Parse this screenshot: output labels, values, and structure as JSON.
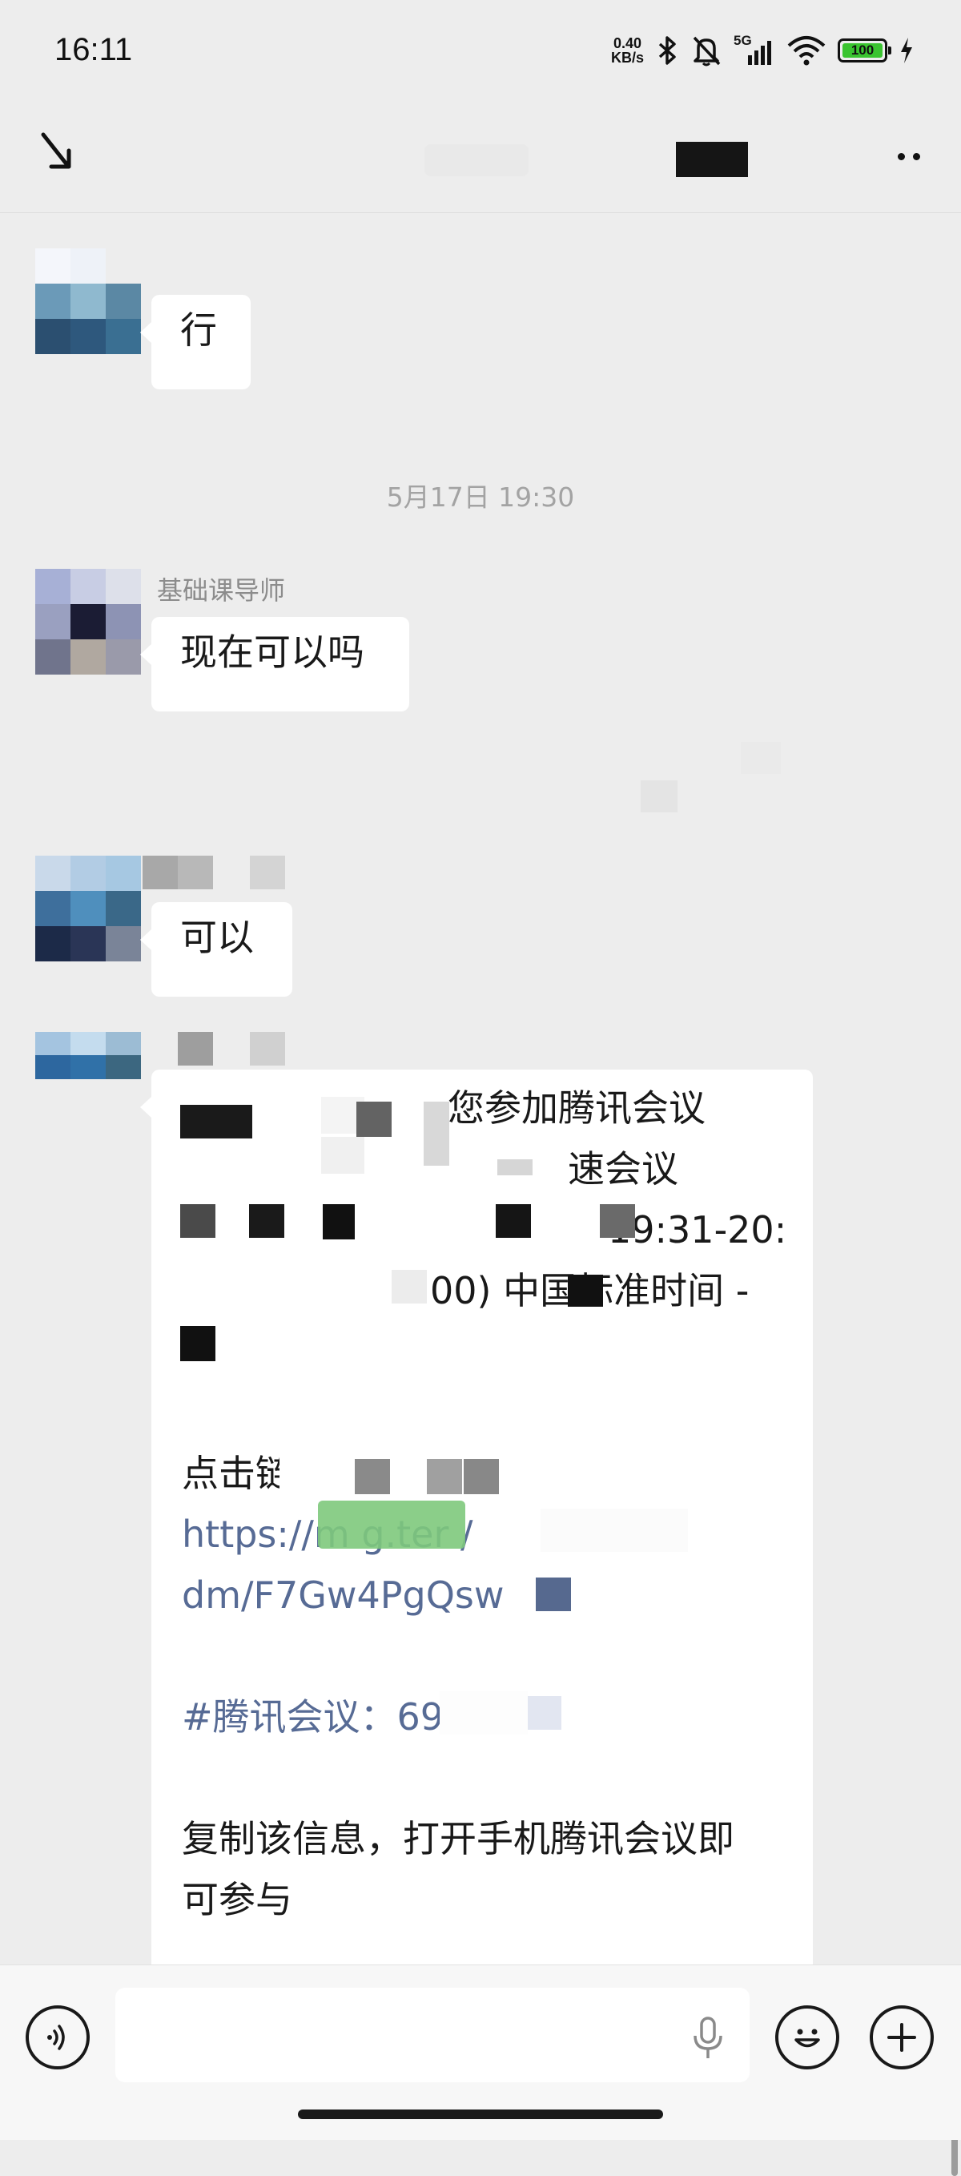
{
  "status_bar": {
    "time": "16:11",
    "net_speed_value": "0.40",
    "net_speed_unit": "KB/s",
    "network": "5G",
    "battery": "100",
    "icons": [
      "bluetooth-icon",
      "bell-muted-icon",
      "signal-icon",
      "wifi-icon",
      "battery-icon",
      "charging-icon"
    ]
  },
  "nav": {
    "back_icon": "back-arrow-icon",
    "more_icon": "more-icon"
  },
  "chat": {
    "messages": [
      {
        "text": "行"
      },
      {
        "timestamp": "5月17日 19:30"
      },
      {
        "sender": "基础课导师",
        "text": "现在可以吗"
      },
      {
        "text": "可以"
      },
      {
        "lines": [
          "您参加腾讯会议",
          "速会议",
          "19:31-20:",
          "00) 中国标准时间 -",
          "",
          "点击链接入会",
          "https://m         g.ter              /",
          "dm/F7Gw4PgQsw",
          "#腾讯会议：695-1",
          "复制该信息，打开手机腾讯会议即",
          "可参与"
        ]
      }
    ]
  },
  "input_bar": {
    "voice_icon": "voice-mode-icon",
    "mic_icon": "microphone-icon",
    "emoji_icon": "emoji-icon",
    "plus_icon": "plus-icon"
  },
  "colors": {
    "background": "#ededed",
    "bubble": "#ffffff",
    "link": "#576b95",
    "battery_fill": "#3ac430",
    "timestamp": "#a3a3a3"
  }
}
